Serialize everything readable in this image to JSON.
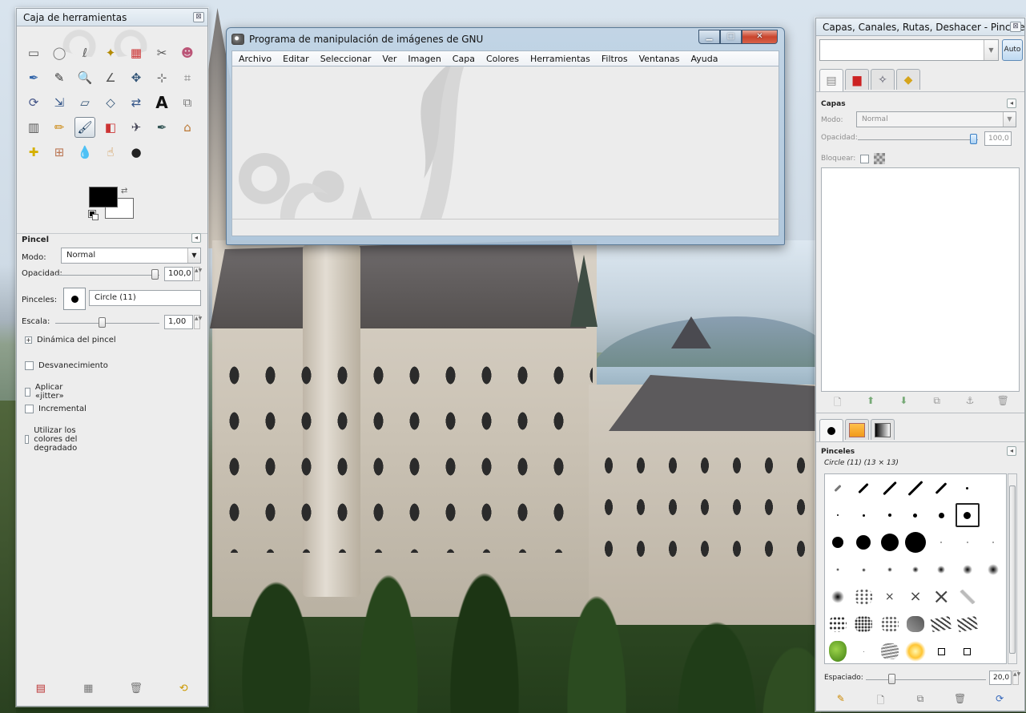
{
  "toolbox": {
    "title": "Caja de herramientas",
    "tools": [
      "rect-select",
      "ellipse-select",
      "free-select",
      "fuzzy-select",
      "color-select",
      "scissors-select",
      "foreground-select",
      "paths",
      "color-picker",
      "zoom",
      "measure",
      "move",
      "alignment",
      "crop",
      "rotate",
      "scale",
      "shear",
      "perspective",
      "flip",
      "text",
      "cage",
      "blend",
      "pencil",
      "paintbrush",
      "eraser",
      "airbrush",
      "ink",
      "clone",
      "heal",
      "perspective-clone",
      "blur",
      "smudge",
      "dodge-burn"
    ],
    "tool_glyphs": [
      "▭",
      "◯",
      "ℓ",
      "✦",
      "▦",
      "✂",
      "☻",
      "✒",
      "✎",
      "🔍",
      "∠",
      "✥",
      "⊹",
      "⌗",
      "⟳",
      "⇲",
      "▱",
      "◇",
      "⇄",
      "A",
      "⧉",
      "▥",
      "✏",
      "🖌",
      "◧",
      "✈",
      "✒",
      "⌂",
      "✚",
      "⊞",
      "💧",
      "☝",
      "●"
    ],
    "active_tool_index": 23,
    "fg_color": "#000000",
    "bg_color": "#ffffff"
  },
  "tool_options": {
    "title": "Pincel",
    "mode_label": "Modo:",
    "mode_value": "Normal",
    "opacity_label": "Opacidad:",
    "opacity_value": "100,0",
    "opacity_level": 1.0,
    "brush_label": "Pinceles:",
    "brush_value": "Circle (11)",
    "scale_label": "Escala:",
    "scale_value": "1,00",
    "scale_level": 0.45,
    "dynamics_label": "Dinámica del pincel",
    "options": [
      {
        "label": "Desvanecimiento",
        "checked": false
      },
      {
        "label": "Aplicar «jitter»",
        "checked": false
      },
      {
        "label": "Incremental",
        "checked": false
      },
      {
        "label": "Utilizar los colores del degradado",
        "checked": false
      }
    ],
    "bottom_buttons": [
      "save-options-icon",
      "restore-options-icon",
      "delete-options-icon",
      "reset-options-icon"
    ]
  },
  "main_window": {
    "title": "Programa de manipulación de imágenes de GNU",
    "menu": [
      "Archivo",
      "Editar",
      "Seleccionar",
      "Ver",
      "Imagen",
      "Capa",
      "Colores",
      "Herramientas",
      "Filtros",
      "Ventanas",
      "Ayuda"
    ]
  },
  "dock": {
    "title": "Capas, Canales, Rutas, Deshacer - Pinceles,...",
    "auto_label": "Auto",
    "layers": {
      "title": "Capas",
      "mode_label": "Modo:",
      "mode_value": "Normal",
      "opacity_label": "Opacidad:",
      "opacity_value": "100,0",
      "opacity_level": 1.0,
      "lock_label": "Bloquear:"
    },
    "brushes": {
      "title": "Pinceles",
      "current": "Circle (11) (13 × 13)",
      "spacing_label": "Espaciado:",
      "spacing_value": "20,0",
      "spacing_level": 0.2
    }
  }
}
